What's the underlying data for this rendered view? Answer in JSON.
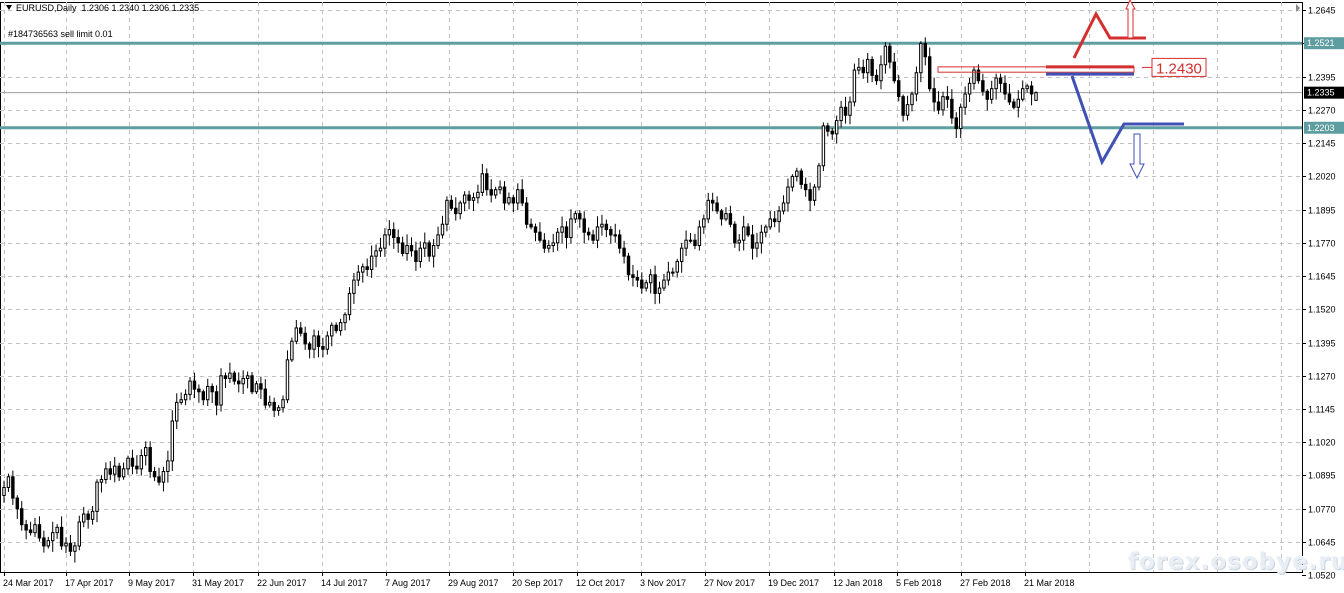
{
  "header": {
    "symbol": "EURUSD,Daily",
    "ohlc": "1.2306 1.2340 1.2306 1.2335",
    "order": "#184736563 sell limit 0.01"
  },
  "watermark": "forex.osobye.ru",
  "colors": {
    "candle": "#000000",
    "grid": "#c0c0c0",
    "level_line": "#5f9ea0",
    "bull_path": "#d32f2f",
    "bear_path": "#3f51b5",
    "order_box": "#d32f2f",
    "price_tag_bg": "#000000",
    "level_tag_bg": "#5f9ea0"
  },
  "chart_data": {
    "type": "candlestick",
    "title": "EURUSD,Daily",
    "timeframe": "Daily",
    "ylim": [
      1.0532,
      1.2676
    ],
    "grid": true,
    "y_ticks": [
      "1.2645",
      "1.2520",
      "1.2395",
      "1.2270",
      "1.2145",
      "1.2020",
      "1.1895",
      "1.1770",
      "1.1645",
      "1.1520",
      "1.1395",
      "1.1270",
      "1.1145",
      "1.1020",
      "1.0895",
      "1.0770",
      "1.0645",
      "1.0520"
    ],
    "x_ticks": [
      "24 Mar 2017",
      "17 Apr 2017",
      "9 May 2017",
      "31 May 2017",
      "22 Jun 2017",
      "14 Jul 2017",
      "7 Aug 2017",
      "29 Aug 2017",
      "20 Sep 2017",
      "12 Oct 2017",
      "3 Nov 2017",
      "27 Nov 2017",
      "19 Dec 2017",
      "12 Jan 2018",
      "5 Feb 2018",
      "27 Feb 2018",
      "21 Mar 2018"
    ],
    "current_price": "1.2335",
    "last_bar": {
      "open": 1.2306,
      "high": 1.234,
      "low": 1.2306,
      "close": 1.2335
    },
    "levels": [
      {
        "name": "resistance",
        "value": 1.2521,
        "label": "1.2521"
      },
      {
        "name": "support",
        "value": 1.2203,
        "label": "1.2203"
      }
    ],
    "sell_limit_label": "1.2430",
    "sell_limit": 1.243,
    "sell_limit_zone": [
      1.2412,
      1.2432
    ],
    "price_path_close": [
      1.085,
      1.089,
      1.081,
      1.077,
      1.071,
      1.069,
      1.068,
      1.071,
      1.066,
      1.063,
      1.065,
      1.068,
      1.07,
      1.063,
      1.064,
      1.061,
      1.063,
      1.072,
      1.075,
      1.073,
      1.076,
      1.087,
      1.088,
      1.092,
      1.09,
      1.093,
      1.089,
      1.092,
      1.096,
      1.093,
      1.092,
      1.097,
      1.1,
      1.091,
      1.089,
      1.087,
      1.091,
      1.095,
      1.11,
      1.117,
      1.118,
      1.12,
      1.125,
      1.122,
      1.121,
      1.118,
      1.123,
      1.121,
      1.116,
      1.127,
      1.126,
      1.128,
      1.125,
      1.124,
      1.126,
      1.127,
      1.121,
      1.124,
      1.122,
      1.116,
      1.117,
      1.114,
      1.115,
      1.118,
      1.133,
      1.14,
      1.145,
      1.143,
      1.139,
      1.137,
      1.142,
      1.138,
      1.137,
      1.142,
      1.146,
      1.144,
      1.147,
      1.15,
      1.158,
      1.163,
      1.166,
      1.168,
      1.167,
      1.172,
      1.174,
      1.175,
      1.18,
      1.182,
      1.179,
      1.177,
      1.173,
      1.176,
      1.174,
      1.17,
      1.175,
      1.177,
      1.172,
      1.176,
      1.18,
      1.184,
      1.193,
      1.19,
      1.188,
      1.192,
      1.195,
      1.193,
      1.194,
      1.196,
      1.203,
      1.197,
      1.195,
      1.197,
      1.198,
      1.192,
      1.194,
      1.192,
      1.197,
      1.192,
      1.184,
      1.183,
      1.181,
      1.178,
      1.175,
      1.176,
      1.177,
      1.181,
      1.183,
      1.179,
      1.186,
      1.188,
      1.186,
      1.181,
      1.18,
      1.178,
      1.183,
      1.184,
      1.182,
      1.18,
      1.18,
      1.175,
      1.172,
      1.165,
      1.164,
      1.163,
      1.16,
      1.162,
      1.165,
      1.158,
      1.16,
      1.163,
      1.166,
      1.166,
      1.17,
      1.175,
      1.178,
      1.178,
      1.176,
      1.183,
      1.186,
      1.193,
      1.192,
      1.189,
      1.186,
      1.188,
      1.184,
      1.177,
      1.178,
      1.183,
      1.18,
      1.175,
      1.177,
      1.181,
      1.183,
      1.186,
      1.185,
      1.189,
      1.192,
      1.198,
      1.202,
      1.204,
      1.199,
      1.197,
      1.193,
      1.198,
      1.206,
      1.221,
      1.219,
      1.218,
      1.223,
      1.228,
      1.225,
      1.23,
      1.242,
      1.243,
      1.241,
      1.246,
      1.24,
      1.238,
      1.244,
      1.251,
      1.245,
      1.238,
      1.232,
      1.225,
      1.229,
      1.233,
      1.241,
      1.252,
      1.247,
      1.235,
      1.23,
      1.227,
      1.232,
      1.231,
      1.224,
      1.22,
      1.228,
      1.233,
      1.237,
      1.242,
      1.238,
      1.234,
      1.231,
      1.235,
      1.239,
      1.237,
      1.233,
      1.23,
      1.228,
      1.231,
      1.235,
      1.236,
      1.233,
      1.2335
    ],
    "annotations": [
      {
        "type": "bullish-scenario",
        "color": "red",
        "target": "up-arrow"
      },
      {
        "type": "bearish-scenario",
        "color": "blue",
        "target": "down-arrow"
      }
    ]
  }
}
